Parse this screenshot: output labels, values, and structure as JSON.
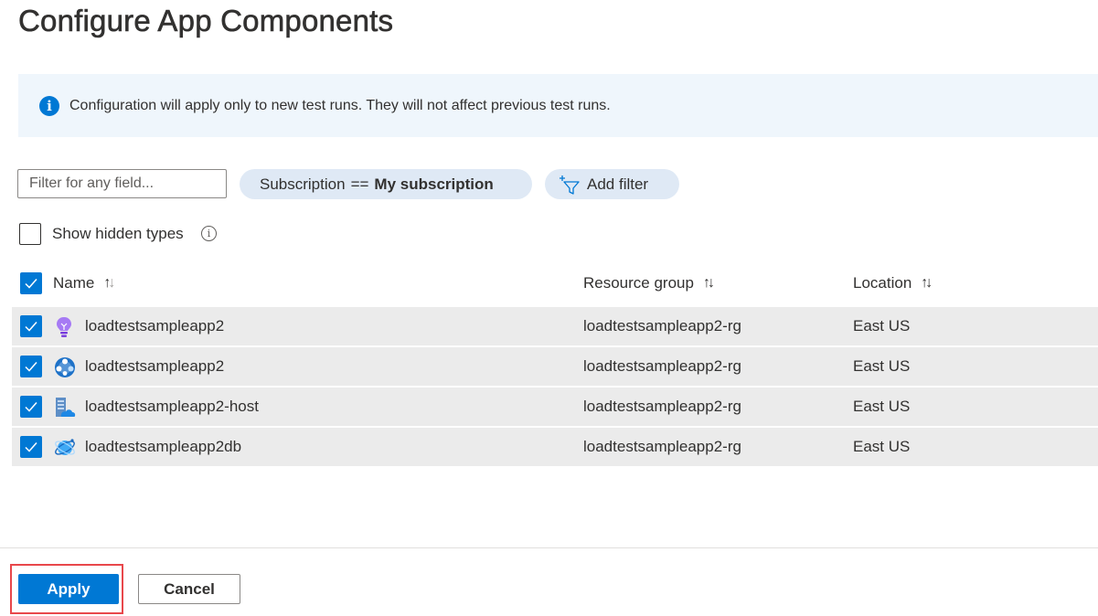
{
  "page": {
    "title": "Configure App Components"
  },
  "info": {
    "message": "Configuration will apply only to new test runs. They will not affect previous test runs."
  },
  "filters": {
    "search_placeholder": "Filter for any field...",
    "subscription_field": "Subscription",
    "subscription_operator": "==",
    "subscription_value": "My subscription",
    "add_filter_label": "Add filter"
  },
  "options": {
    "show_hidden_types_label": "Show hidden types",
    "show_hidden_types_checked": false
  },
  "table": {
    "columns": {
      "name": "Name",
      "resource_group": "Resource group",
      "location": "Location"
    },
    "select_all_checked": true,
    "rows": [
      {
        "name": "loadtestsampleapp2",
        "resource_group": "loadtestsampleapp2-rg",
        "location": "East US",
        "icon": "application-insights-icon",
        "checked": true
      },
      {
        "name": "loadtestsampleapp2",
        "resource_group": "loadtestsampleapp2-rg",
        "location": "East US",
        "icon": "app-service-icon",
        "checked": true
      },
      {
        "name": "loadtestsampleapp2-host",
        "resource_group": "loadtestsampleapp2-rg",
        "location": "East US",
        "icon": "app-service-plan-icon",
        "checked": true
      },
      {
        "name": "loadtestsampleapp2db",
        "resource_group": "loadtestsampleapp2-rg",
        "location": "East US",
        "icon": "cosmos-db-icon",
        "checked": true
      }
    ]
  },
  "footer": {
    "apply_label": "Apply",
    "cancel_label": "Cancel"
  },
  "colors": {
    "accent": "#0078d4",
    "info_background": "#eff6fc",
    "row_background": "#ebebeb",
    "highlight_border": "#e8474b"
  }
}
